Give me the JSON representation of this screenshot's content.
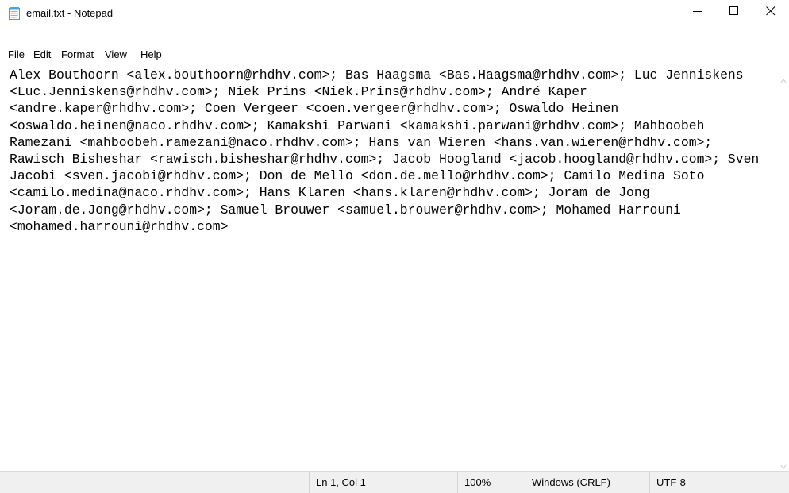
{
  "window": {
    "title": "email.txt - Notepad",
    "minimize_label": "—",
    "maximize_label": "☐",
    "close_label": "✕"
  },
  "menu": {
    "items": [
      "File",
      "Edit",
      "Format",
      "View",
      "Help"
    ]
  },
  "editor": {
    "content": "Alex Bouthoorn <alex.bouthoorn@rhdhv.com>; Bas Haagsma <Bas.Haagsma@rhdhv.com>; Luc Jenniskens <Luc.Jenniskens@rhdhv.com>; Niek Prins <Niek.Prins@rhdhv.com>; André Kaper <andre.kaper@rhdhv.com>; Coen Vergeer <coen.vergeer@rhdhv.com>; Oswaldo Heinen <oswaldo.heinen@naco.rhdhv.com>; Kamakshi Parwani <kamakshi.parwani@rhdhv.com>; Mahboobeh Ramezani <mahboobeh.ramezani@naco.rhdhv.com>; Hans van Wieren <hans.van.wieren@rhdhv.com>; Rawisch Bisheshar <rawisch.bisheshar@rhdhv.com>; Jacob Hoogland <jacob.hoogland@rhdhv.com>; Sven Jacobi <sven.jacobi@rhdhv.com>; Don de Mello <don.de.mello@rhdhv.com>; Camilo Medina Soto <camilo.medina@naco.rhdhv.com>; Hans Klaren <hans.klaren@rhdhv.com>; Joram de Jong <Joram.de.Jong@rhdhv.com>; Samuel Brouwer <samuel.brouwer@rhdhv.com>; Mohamed Harrouni <mohamed.harrouni@rhdhv.com>"
  },
  "status": {
    "position": "Ln 1, Col 1",
    "zoom": "100%",
    "line_ending": "Windows (CRLF)",
    "encoding": "UTF-8"
  },
  "icons": {
    "app": "notepad-icon",
    "minimize": "minimize-icon",
    "maximize": "maximize-icon",
    "close": "close-icon"
  }
}
